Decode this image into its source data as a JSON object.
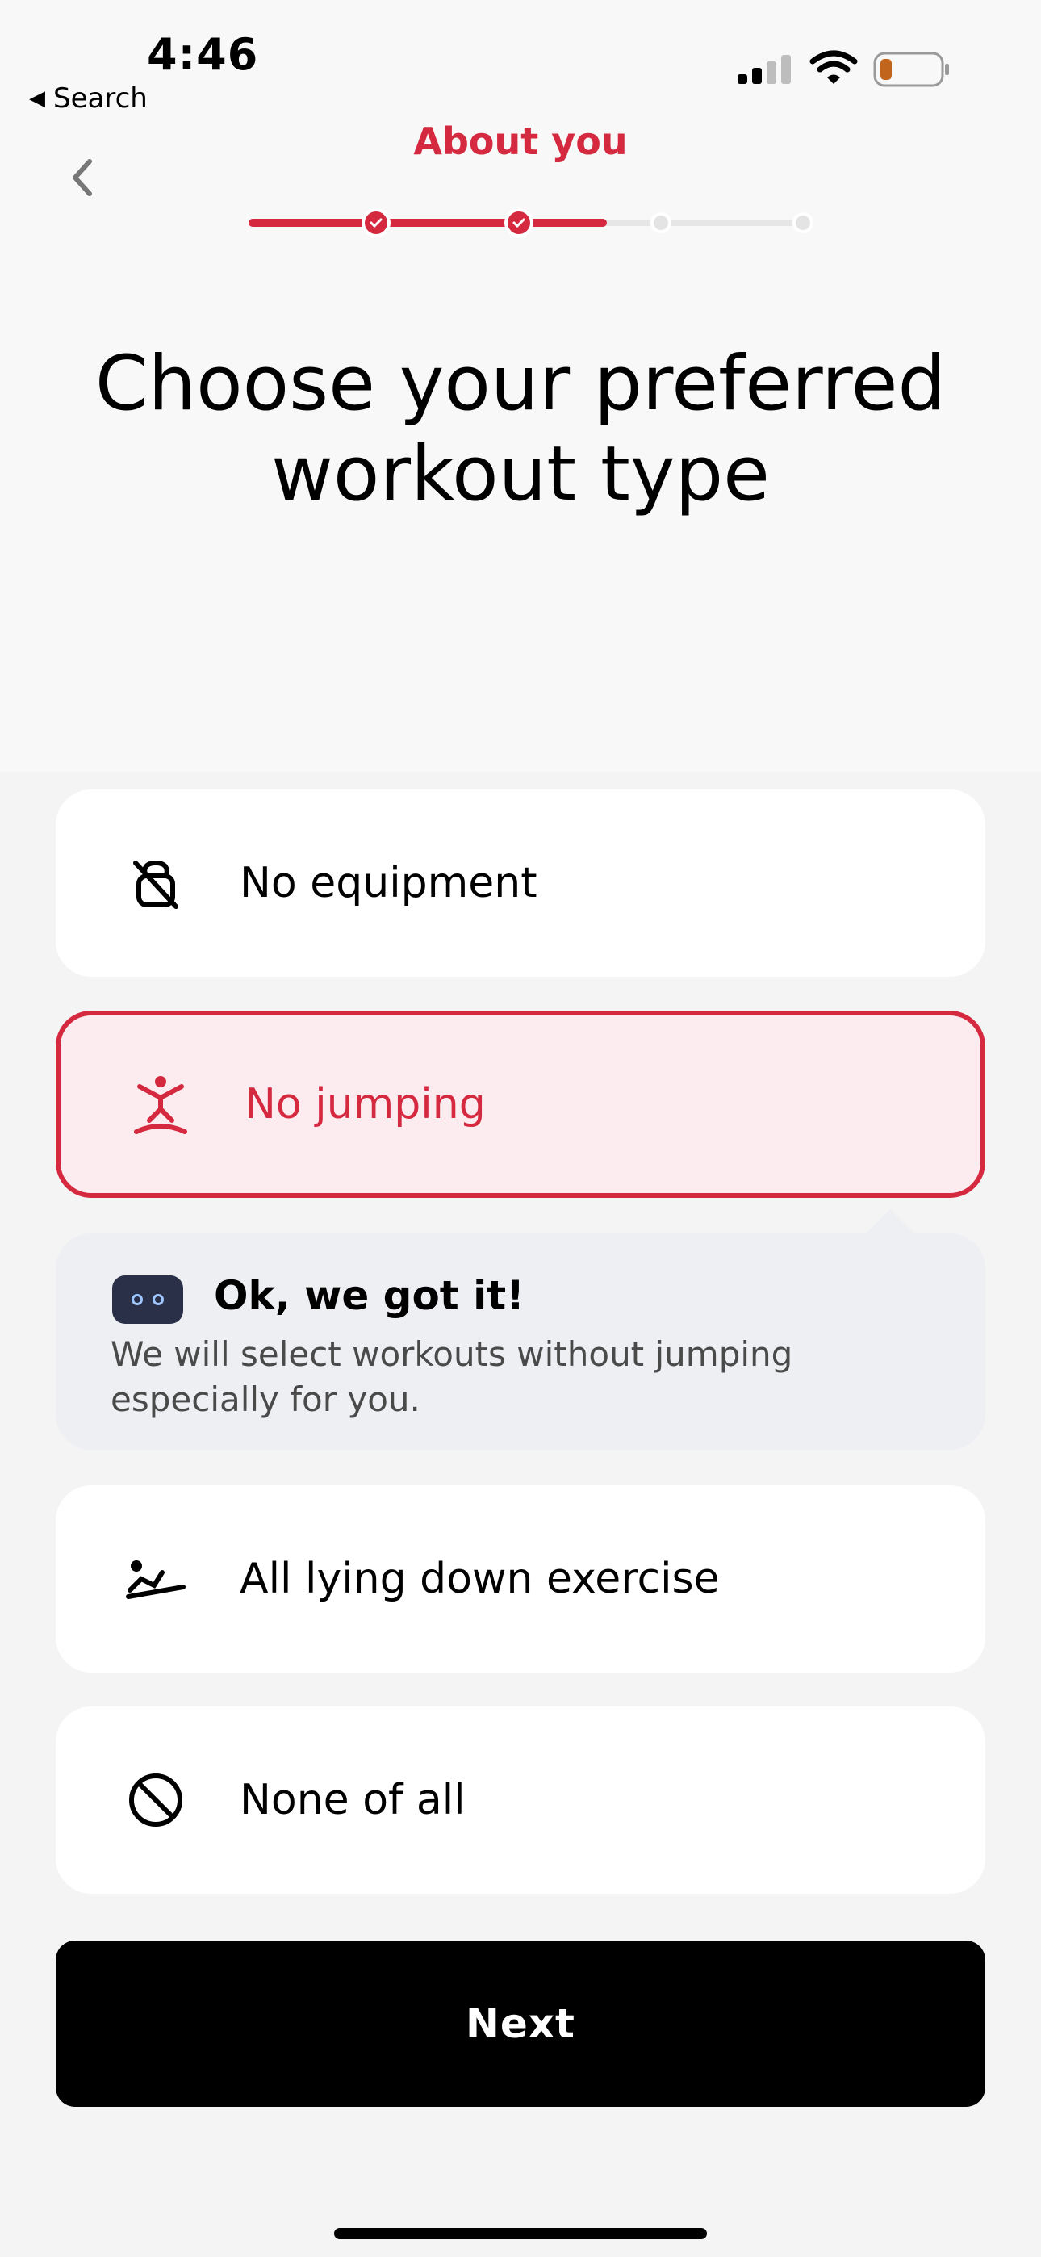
{
  "status_bar": {
    "time": "4:46",
    "back_app_label": "Search",
    "signal_icon": "cellular-signal-icon",
    "wifi_icon": "wifi-icon",
    "battery_icon": "battery-low-icon",
    "battery_color": "#c0651b"
  },
  "header": {
    "title": "About you",
    "back_icon": "chevron-left-icon",
    "progress_steps": [
      "done",
      "done",
      "todo",
      "todo"
    ],
    "progress_fraction": 0.62,
    "accent_color": "#d4293f"
  },
  "headline": {
    "line1": "Choose your preferred",
    "line2": "workout type"
  },
  "options": [
    {
      "label": "No equipment",
      "icon": "no-kettlebell-icon",
      "selected": false
    },
    {
      "label": "No jumping",
      "icon": "no-jumping-icon",
      "selected": true
    },
    {
      "label": "All lying down exercise",
      "icon": "lying-down-icon",
      "selected": false
    },
    {
      "label": "None of all",
      "icon": "prohibited-icon",
      "selected": false
    }
  ],
  "feedback": {
    "icon": "robot-icon",
    "title": "Ok, we got it!",
    "text": "We will select workouts without jumping especially for you."
  },
  "footer": {
    "next_label": "Next"
  }
}
